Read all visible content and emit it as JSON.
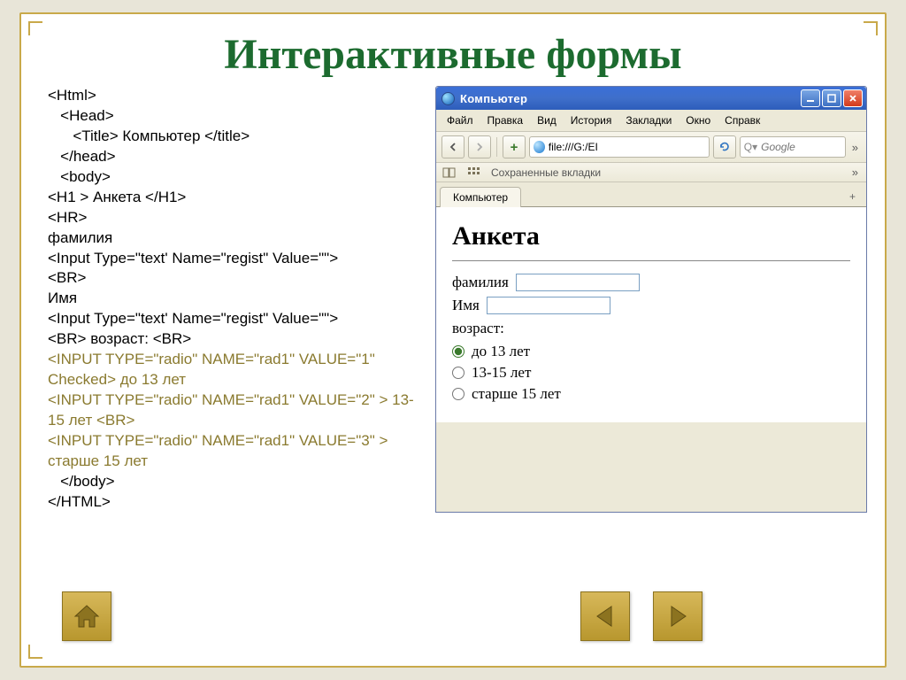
{
  "slide_title": "Интерактивные формы",
  "code": {
    "lines_top": "<Html>\n   <Head>\n      <Title> Компьютер </title>\n   </head>\n   <body>\n<H1 > Анкета </H1>\n<HR>\nфамилия\n<Input Type=\"text' Name=\"regist\" Value=\"\">\n<BR>\nИмя\n<Input Type=\"text' Name=\"regist\" Value=\"\">\n<BR> возраст: <BR>",
    "lines_olive": "<INPUT TYPE=\"radio\" NAME=\"rad1\" VALUE=\"1\" Checked> до 13 лет\n<INPUT TYPE=\"radio\" NAME=\"rad1\" VALUE=\"2\" > 13-15 лет <BR>\n<INPUT TYPE=\"radio\" NAME=\"rad1\" VALUE=\"3\" > старше 15 лет",
    "lines_bottom": "   </body>\n</HTML>"
  },
  "browser": {
    "window_title": "Компьютер",
    "menubar": [
      "Файл",
      "Правка",
      "Вид",
      "История",
      "Закладки",
      "Окно",
      "Справк"
    ],
    "address_value": "file:///G:/EI",
    "search_placeholder": "Google",
    "bookmarks_label": "Сохраненные вкладки",
    "tab_label": "Компьютер",
    "page": {
      "heading": "Анкета",
      "surname_label": "фамилия",
      "name_label": "Имя",
      "age_label": "возраст:",
      "radios": [
        "до 13 лет",
        "13-15 лет",
        "старше 15 лет"
      ]
    }
  }
}
